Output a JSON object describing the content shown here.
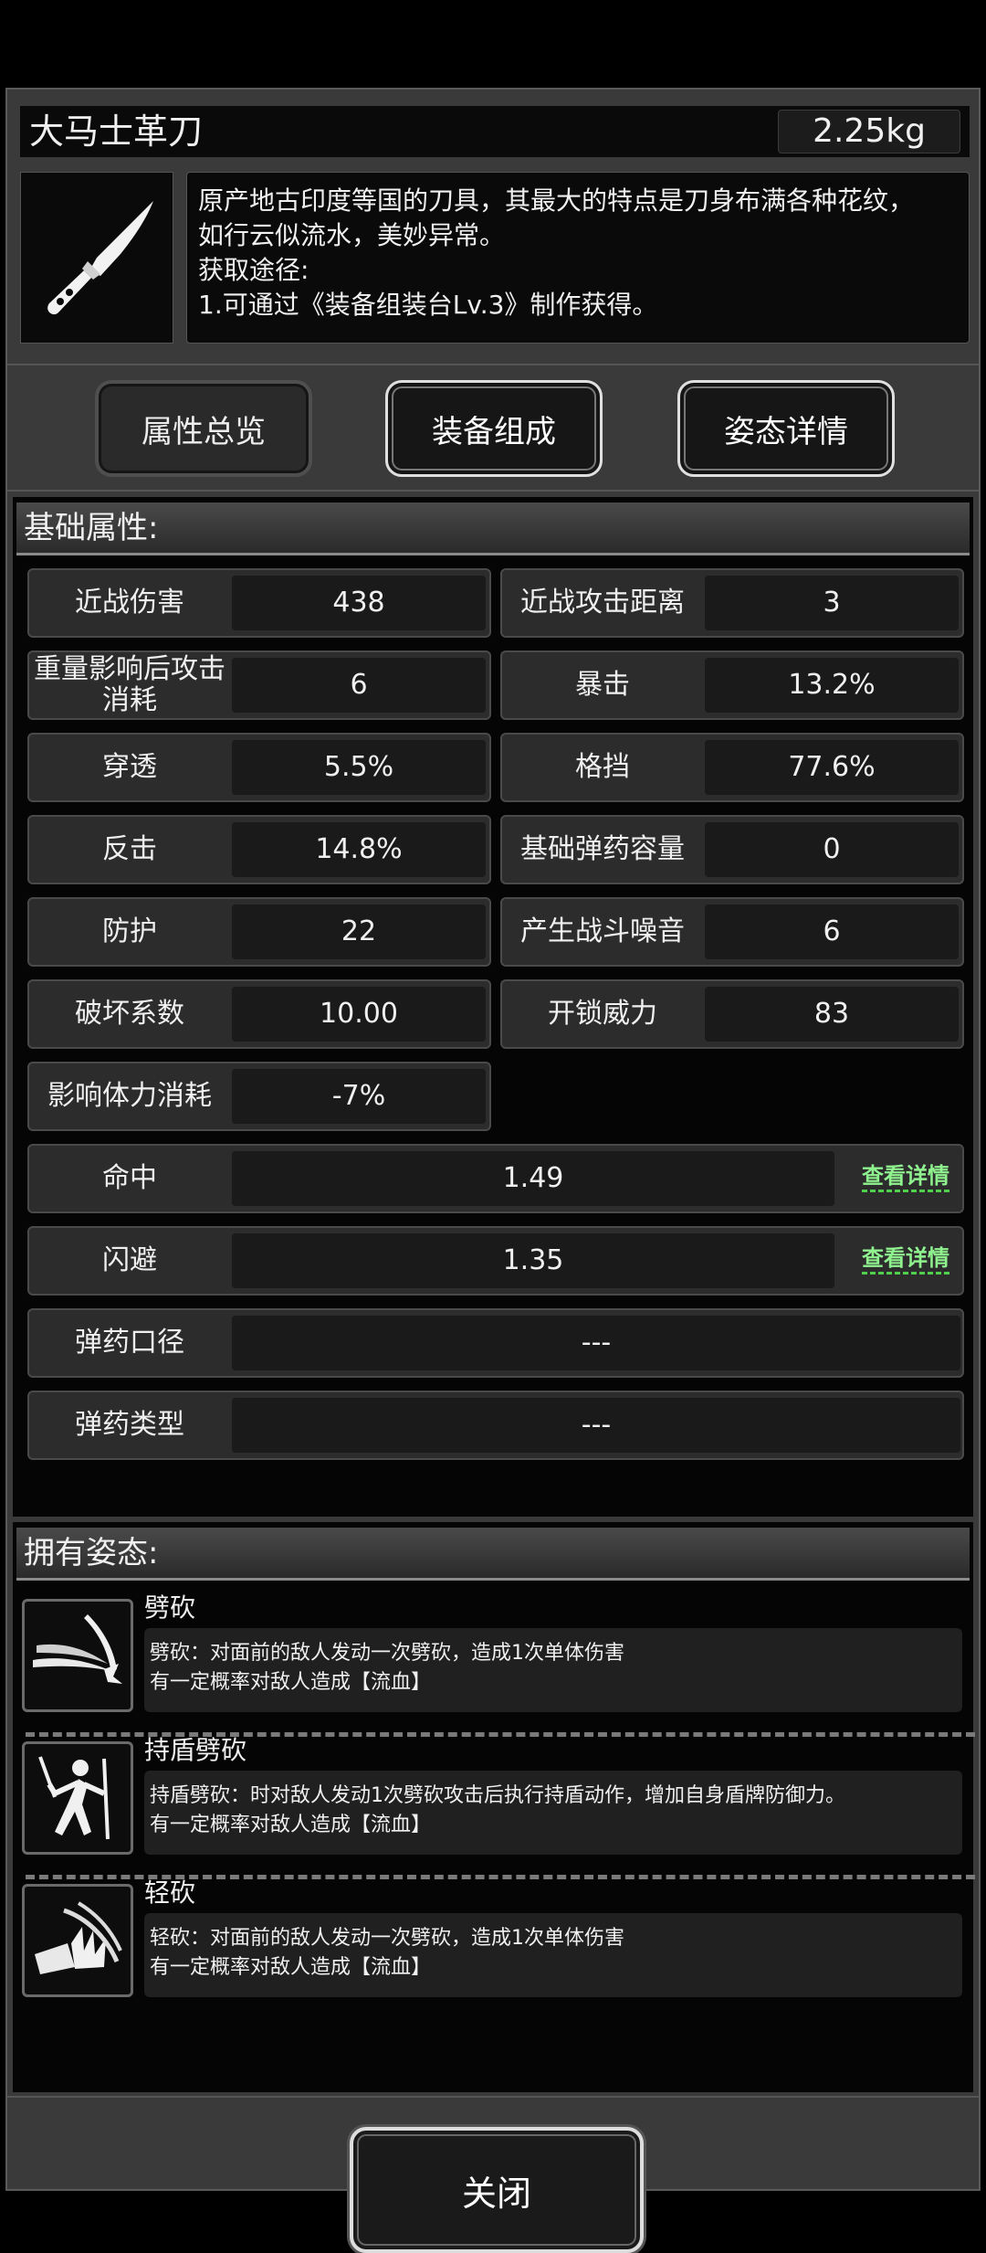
{
  "item": {
    "name": "大马士革刀",
    "weight": "2.25kg",
    "icon": "knife-icon",
    "description": [
      "原产地古印度等国的刀具，其最大的特点是刀身布满各种花纹，",
      "如行云似流水，美妙异常。",
      "获取途径:",
      "1.可通过《装备组装台Lv.3》制作获得。"
    ]
  },
  "tabs": [
    {
      "label": "属性总览",
      "active": true
    },
    {
      "label": "装备组成",
      "active": false
    },
    {
      "label": "姿态详情",
      "active": false
    }
  ],
  "base_attributes": {
    "title": "基础属性:",
    "grid": [
      {
        "label": "近战伤害",
        "value": "438"
      },
      {
        "label": "近战攻击距离",
        "value": "3"
      },
      {
        "label": "重量影响后攻击消耗",
        "value": "6"
      },
      {
        "label": "暴击",
        "value": "13.2%"
      },
      {
        "label": "穿透",
        "value": "5.5%"
      },
      {
        "label": "格挡",
        "value": "77.6%"
      },
      {
        "label": "反击",
        "value": "14.8%"
      },
      {
        "label": "基础弹药容量",
        "value": "0"
      },
      {
        "label": "防护",
        "value": "22"
      },
      {
        "label": "产生战斗噪音",
        "value": "6"
      },
      {
        "label": "破坏系数",
        "value": "10.00"
      },
      {
        "label": "开锁威力",
        "value": "83"
      },
      {
        "label": "影响体力消耗",
        "value": "-7%"
      }
    ],
    "wide": [
      {
        "label": "命中",
        "value": "1.49",
        "link": "查看详情"
      },
      {
        "label": "闪避",
        "value": "1.35",
        "link": "查看详情"
      },
      {
        "label": "弹药口径",
        "value": "---"
      },
      {
        "label": "弹药类型",
        "value": "---"
      }
    ]
  },
  "stances": {
    "title": "拥有姿态:",
    "items": [
      {
        "name": "劈砍",
        "icon": "slash-icon",
        "lines": [
          "劈砍：对面前的敌人发动一次劈砍，造成1次单体伤害",
          "有一定概率对敌人造成【流血】"
        ]
      },
      {
        "name": "持盾劈砍",
        "icon": "shield-slash-icon",
        "lines": [
          "持盾劈砍：时对敌人发动1次劈砍攻击后执行持盾动作，增加自身盾牌防御力。",
          "有一定概率对敌人造成【流血】"
        ]
      },
      {
        "name": "轻砍",
        "icon": "light-slash-icon",
        "lines": [
          "轻砍：对面前的敌人发动一次劈砍，造成1次单体伤害",
          "有一定概率对敌人造成【流血】"
        ]
      }
    ]
  },
  "footer": {
    "close_label": "关闭"
  },
  "colors": {
    "link_green": "#8ff28f",
    "panel": "#3a3a3a"
  }
}
